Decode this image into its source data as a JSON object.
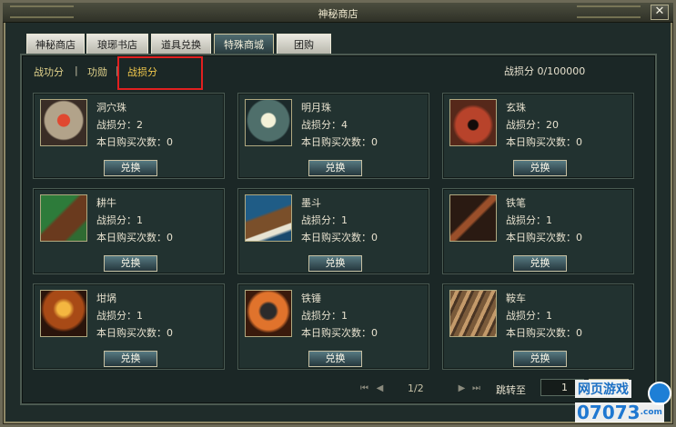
{
  "window": {
    "title": "神秘商店",
    "close_symbol": "✕"
  },
  "tabs": [
    {
      "label": "神秘商店"
    },
    {
      "label": "琅琊书店"
    },
    {
      "label": "道具兑换"
    },
    {
      "label": "特殊商城"
    },
    {
      "label": "团购"
    }
  ],
  "subtabs": [
    {
      "label": "战功分"
    },
    {
      "label": "功勋"
    },
    {
      "label": "战损分"
    }
  ],
  "separator": "|",
  "score_text": "战损分 0/100000",
  "items": [
    {
      "name": "洞穴珠",
      "cost": "战损分：2",
      "daily": "本日购买次数：0",
      "button": "兑换",
      "icon": "pearl-shell-icon"
    },
    {
      "name": "明月珠",
      "cost": "战损分：4",
      "daily": "本日购买次数：0",
      "button": "兑换",
      "icon": "moon-pearl-icon"
    },
    {
      "name": "玄珠",
      "cost": "战损分：20",
      "daily": "本日购买次数：0",
      "button": "兑换",
      "icon": "black-pearl-box-icon"
    },
    {
      "name": "耕牛",
      "cost": "战损分：1",
      "daily": "本日购买次数：0",
      "button": "兑换",
      "icon": "ox-icon"
    },
    {
      "name": "墨斗",
      "cost": "战损分：1",
      "daily": "本日购买次数：0",
      "button": "兑换",
      "icon": "ink-line-icon"
    },
    {
      "name": "铁笔",
      "cost": "战损分：1",
      "daily": "本日购买次数：0",
      "button": "兑换",
      "icon": "iron-pen-icon"
    },
    {
      "name": "坩埚",
      "cost": "战损分：1",
      "daily": "本日购买次数：0",
      "button": "兑换",
      "icon": "crucible-icon"
    },
    {
      "name": "铁锤",
      "cost": "战损分：1",
      "daily": "本日购买次数：0",
      "button": "兑换",
      "icon": "hammer-icon"
    },
    {
      "name": "鞍车",
      "cost": "战损分：1",
      "daily": "本日购买次数：0",
      "button": "兑换",
      "icon": "cart-icon"
    }
  ],
  "pager": {
    "page": "1/2",
    "jump_label": "跳转至",
    "input_value": "1"
  },
  "watermark": {
    "top": "网页游戏",
    "bottom": "07073",
    "suffix": ".com"
  }
}
